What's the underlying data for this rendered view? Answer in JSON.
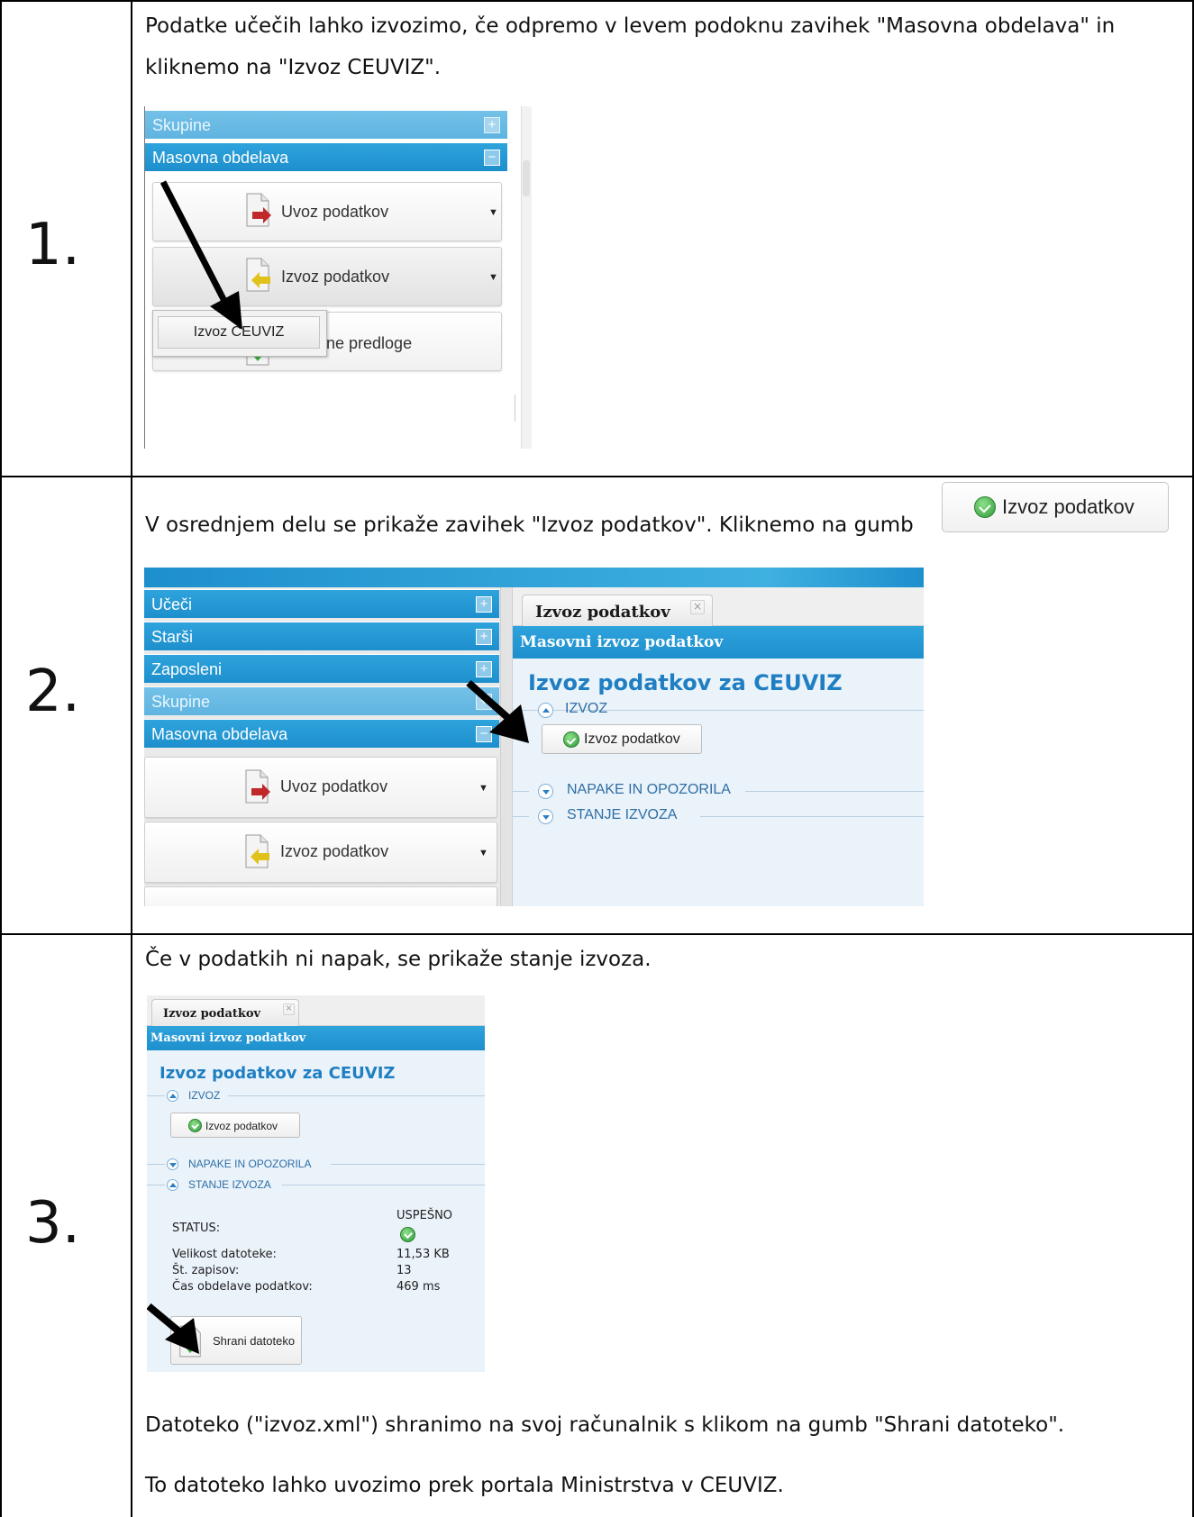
{
  "step_numbers": [
    "1.",
    "2.",
    "3."
  ],
  "step1": {
    "text_line1": "Podatke učečih lahko izvozimo, če odpremo v levem podoknu zavihek \"Masovna obdelava\" in",
    "text_line2": "kliknemo na \"Izvoz CEUVIZ\".",
    "screenshot": {
      "accordion": [
        {
          "label": "Skupine",
          "toggle": "+"
        },
        {
          "label": "Masovna obdelava",
          "toggle": "−"
        }
      ],
      "buttons": [
        {
          "label": "Uvoz podatkov",
          "icon": "document-import-icon"
        },
        {
          "label": "Izvoz podatkov",
          "icon": "document-export-icon"
        },
        {
          "label": "ne predloge",
          "icon": "document-download-icon"
        }
      ],
      "dropdown_item": "Izvoz CEUVIZ"
    }
  },
  "step2": {
    "text": "V osrednjem delu se prikaže zavihek \"Izvoz podatkov\". Kliknemo na gumb",
    "inline_button": "Izvoz podatkov",
    "screenshot": {
      "accordion": [
        {
          "label": "Učeči",
          "toggle": "+"
        },
        {
          "label": "Starši",
          "toggle": "+"
        },
        {
          "label": "Zaposleni",
          "toggle": "+"
        },
        {
          "label": "Skupine",
          "toggle": "+"
        },
        {
          "label": "Masovna obdelava",
          "toggle": "−"
        }
      ],
      "buttons": [
        {
          "label": "Uvoz podatkov",
          "icon": "document-import-icon"
        },
        {
          "label": "Izvoz podatkov",
          "icon": "document-export-icon"
        }
      ],
      "tab_label": "Izvoz podatkov",
      "tab_close": "×",
      "bar_title": "Masovni izvoz podatkov",
      "heading": "Izvoz podatkov za CEUVIZ",
      "section_izvoz": "IZVOZ",
      "export_button": "Izvoz podatkov",
      "section_napake": "NAPAKE IN OPOZORILA",
      "section_stanje": "STANJE IZVOZA"
    }
  },
  "step3": {
    "text_top": "Če v podatkih ni napak, se prikaže stanje izvoza.",
    "screenshot": {
      "tab_label": "Izvoz podatkov",
      "tab_close": "×",
      "bar_title": "Masovni izvoz podatkov",
      "heading": "Izvoz podatkov za CEUVIZ",
      "section_izvoz": "IZVOZ",
      "export_button": "Izvoz podatkov",
      "section_napake": "NAPAKE IN OPOZORILA",
      "section_stanje": "STANJE IZVOZA",
      "status_label": "STATUS:",
      "status_value": "USPEŠNO",
      "rows": [
        {
          "label": "Velikost datoteke:",
          "value": "11,53 KB"
        },
        {
          "label": "Št. zapisov:",
          "value": "13"
        },
        {
          "label": "Čas obdelave podatkov:",
          "value": "469 ms"
        }
      ],
      "save_button": "Shrani datoteko"
    },
    "text_bottom1": "Datoteko (\"izvoz.xml\") shranimo na svoj računalnik s klikom na gumb \"Shrani datoteko\".",
    "text_bottom2": "To datoteko lahko uvozimo prek portala Ministrstva v CEUVIZ."
  },
  "colors": {
    "accent_blue": "#1e8fcd",
    "heading_blue": "#1f7fc2",
    "success_green": "#2f9a3a",
    "import_arrow_red": "#c0282a",
    "export_arrow_yellow": "#e0c21a",
    "download_arrow_green": "#3cae3c"
  }
}
